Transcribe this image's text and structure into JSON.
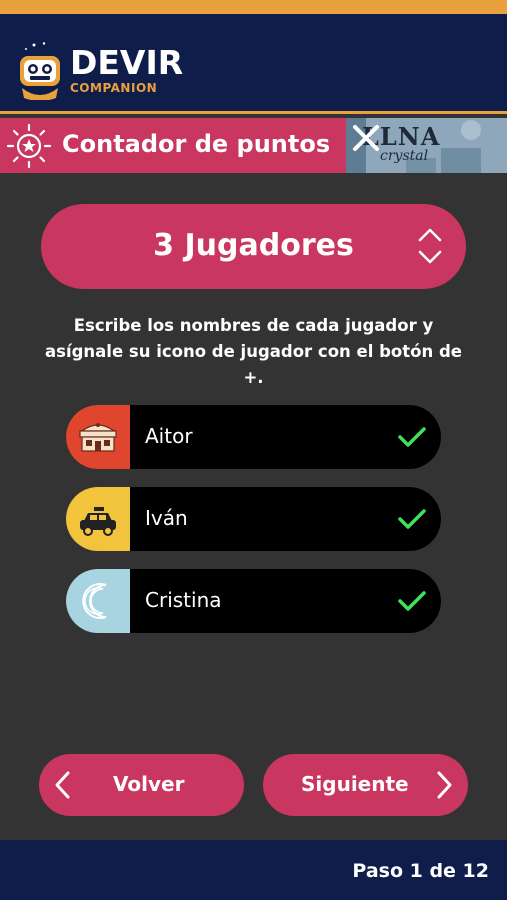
{
  "header": {
    "brand": "DEVIR",
    "sub": "COMPANION"
  },
  "section": {
    "title": "Contador de puntos",
    "game_logo": "LLNA",
    "game_logo_sub": "crystal"
  },
  "selector": {
    "label": "3 Jugadores"
  },
  "instructions": "Escribe los nombres de cada jugador y asígnale su icono de jugador con el botón de +.",
  "players": [
    {
      "name": "Aitor",
      "icon": "bakery-building-icon",
      "color": "#E0452E"
    },
    {
      "name": "Iván",
      "icon": "taxi-icon",
      "color": "#F2C43D"
    },
    {
      "name": "Cristina",
      "icon": "crescent-moon-icon",
      "color": "#A8D3E0"
    }
  ],
  "nav": {
    "back_label": "Volver",
    "next_label": "Siguiente"
  },
  "footer": {
    "step": "Paso 1 de 12"
  },
  "colors": {
    "navy": "#0F1D4A",
    "accent_orange": "#E8A13C",
    "brand_pink": "#C9365F",
    "background": "#333333",
    "check_green": "#3FE05A"
  }
}
